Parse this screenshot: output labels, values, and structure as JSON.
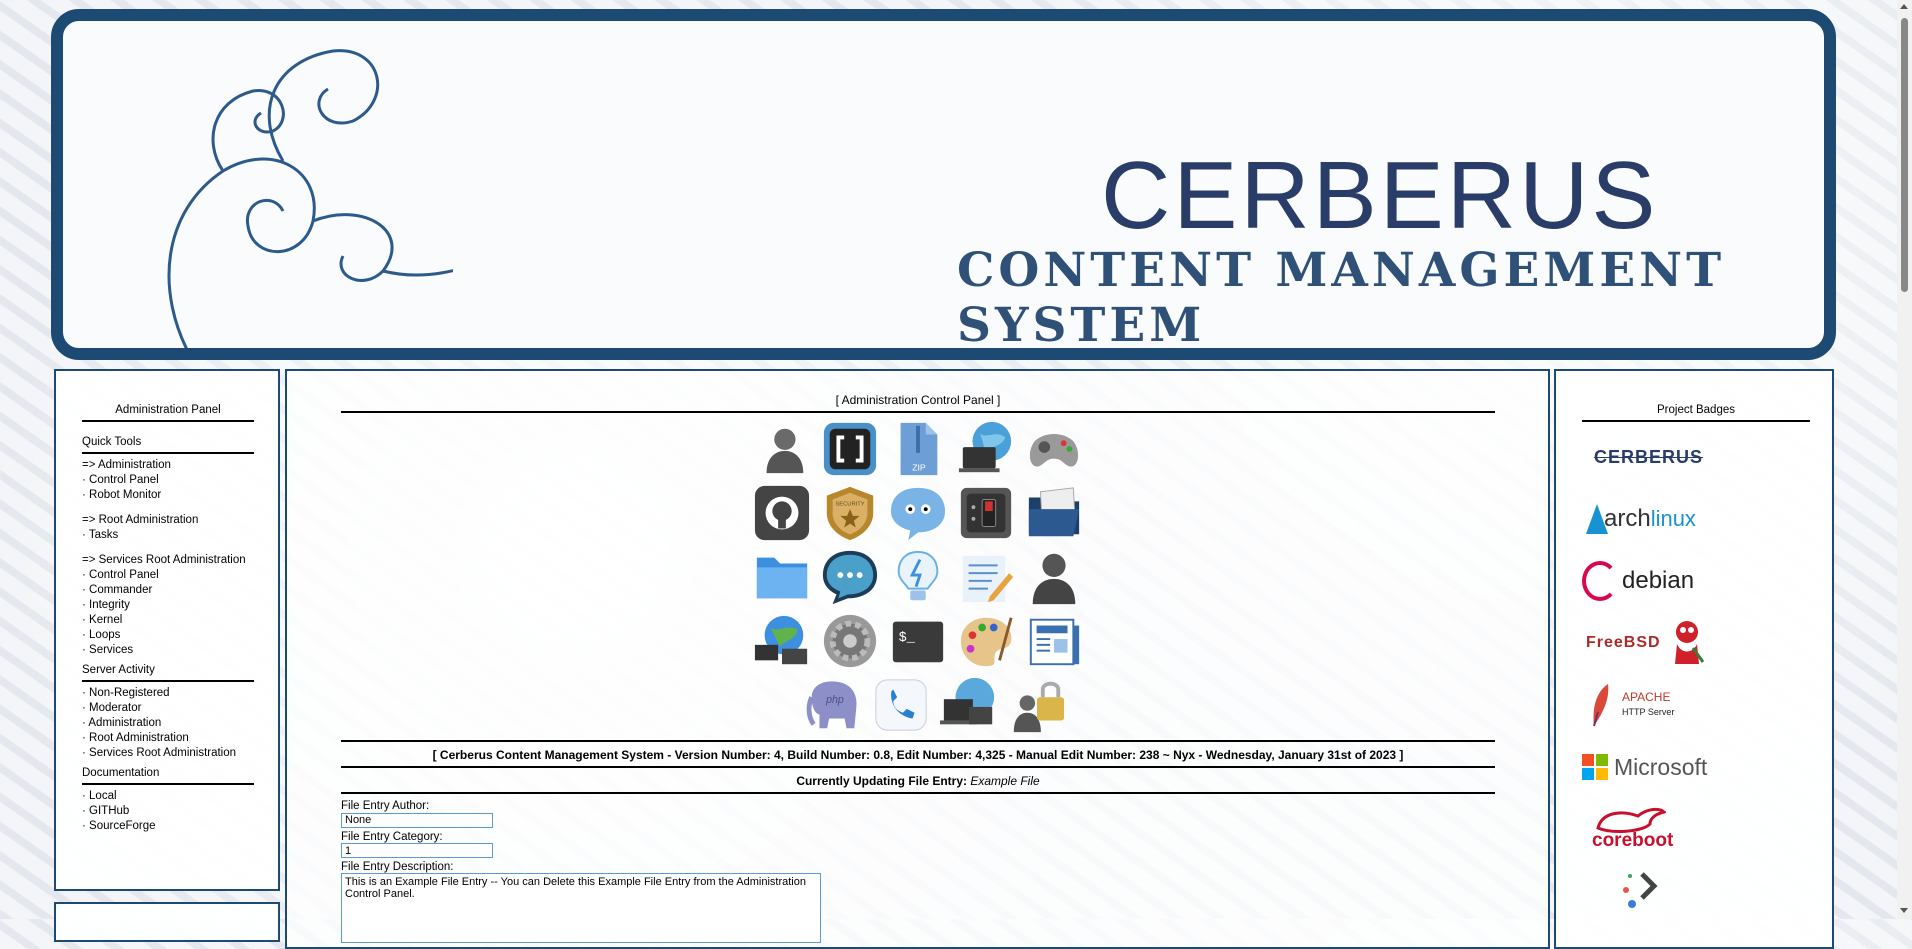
{
  "banner": {
    "title": "CERBERUS",
    "subtitle": "CONTENT MANAGEMENT SYSTEM"
  },
  "sidebar": {
    "admin_panel_title": "Administration Panel",
    "quick_tools_title": "Quick Tools",
    "administration": [
      "=> Administration",
      "· Control Panel",
      "· Robot Monitor"
    ],
    "root_administration": [
      "=> Root Administration",
      "· Tasks"
    ],
    "services_root_administration": [
      "=> Services Root Administration",
      "· Control Panel",
      "· Commander",
      "· Integrity",
      "· Kernel",
      "· Loops",
      "· Services"
    ],
    "server_activity_title": "Server Activity",
    "server_activity": [
      "· Non-Registered",
      "· Moderator",
      "· Administration",
      "· Root Administration",
      "· Services Root Administration"
    ],
    "documentation_title": "Documentation",
    "documentation": [
      "· Local",
      "· GITHub",
      "· SourceForge"
    ]
  },
  "main": {
    "heading": "[ Administration Control Panel ]",
    "version_line": "[ Cerberus Content Management System - Version Number: 4, Build Number: 0.8, Edit Number: 4,325 - Manual Edit Number: 238 ~ Nyx - Wednesday, January 31st of 2023 ]",
    "updating_prefix": "Currently Updating File Entry: ",
    "updating_name": "Example File",
    "icons": [
      [
        "user-icon",
        "brackets-icon",
        "zip-archive-icon",
        "network-globe-icon",
        "gamepad-icon"
      ],
      [
        "github-icon",
        "security-badge-icon",
        "chat-bubble-icon",
        "power-switch-icon",
        "folder-open-icon"
      ],
      [
        "folder-icon",
        "messages-icon",
        "lightbulb-icon",
        "text-editor-icon",
        "user-silhouette-icon"
      ],
      [
        "network-computers-icon",
        "settings-gear-icon",
        "terminal-icon",
        "paint-palette-icon",
        "news-icon"
      ],
      [
        "php-elephant-icon",
        "phone-icon",
        "remote-desktop-icon",
        "user-lock-icon"
      ]
    ],
    "form": {
      "author_label": "File Entry Author:",
      "author_value": "None",
      "category_label": "File Entry Category:",
      "category_value": "1",
      "description_label": "File Entry Description:",
      "description_value": "This is an Example File Entry -- You can Delete this Example File Entry from the Administration Control Panel."
    }
  },
  "badges": {
    "title": "Project Badges",
    "items": [
      {
        "name": "cerberus",
        "text": "CERBERUS"
      },
      {
        "name": "archlinux",
        "text_a": "arch",
        "text_b": "linux"
      },
      {
        "name": "debian",
        "text": "debian"
      },
      {
        "name": "freebsd",
        "text": "FreeBSD"
      },
      {
        "name": "apache",
        "text_a": "APACHE",
        "text_b": "HTTP Server"
      },
      {
        "name": "microsoft",
        "text": "Microsoft"
      },
      {
        "name": "coreboot",
        "text": "coreboot"
      },
      {
        "name": "next",
        "text": ""
      }
    ]
  },
  "colors": {
    "frame": "#1d4a73",
    "title": "#2a3c68",
    "input_border": "#5a9bd5"
  }
}
